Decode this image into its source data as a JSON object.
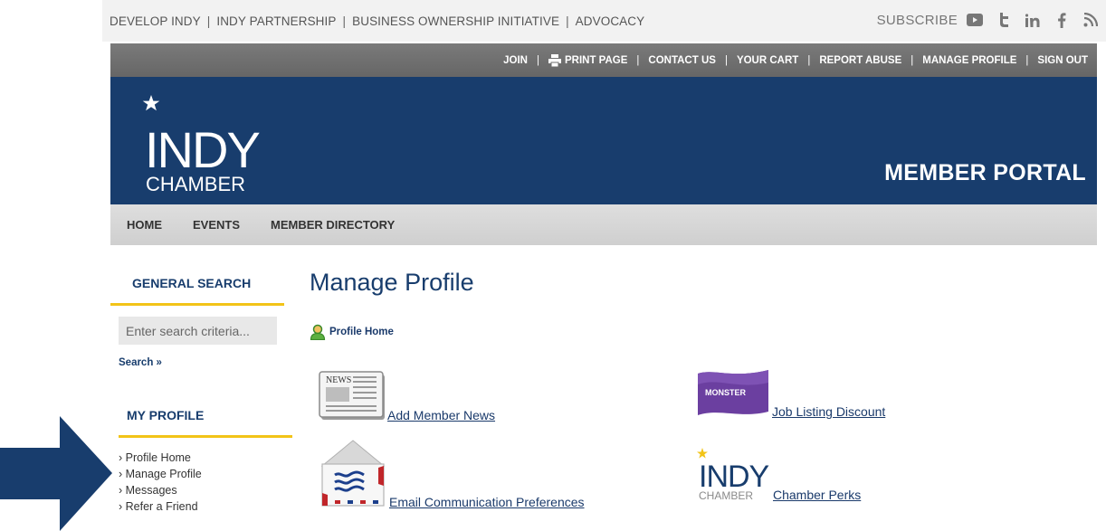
{
  "top_bar": {
    "links": [
      "DEVELOP INDY",
      "INDY PARTNERSHIP",
      "BUSINESS OWNERSHIP INITIATIVE",
      "ADVOCACY"
    ],
    "subscribe_label": "SUBSCRIBE",
    "social_icons": [
      "youtube-icon",
      "twitter-icon",
      "linkedin-icon",
      "facebook-icon",
      "rss-icon"
    ]
  },
  "action_bar": {
    "join": "JOIN",
    "print_page": "PRINT PAGE",
    "contact_us": "CONTACT US",
    "your_cart": "YOUR CART",
    "report_abuse": "REPORT ABUSE",
    "manage_profile": "MANAGE PROFILE",
    "sign_out": "SIGN OUT"
  },
  "header": {
    "logo_text_main": "INDY",
    "logo_text_sub": "CHAMBER",
    "portal_title": "MEMBER PORTAL"
  },
  "nav": {
    "home": "HOME",
    "events": "EVENTS",
    "member_directory": "MEMBER DIRECTORY"
  },
  "sidebar": {
    "search_heading": "GENERAL SEARCH",
    "search_placeholder": "Enter search criteria...",
    "search_link": "Search »",
    "profile_heading": "MY PROFILE",
    "profile_items": [
      "Profile Home",
      "Manage Profile",
      "Messages",
      "Refer a Friend"
    ]
  },
  "main": {
    "title": "Manage Profile",
    "profile_home_link": "Profile Home",
    "tiles": {
      "add_member_news": "Add Member News",
      "news_icon_text": "NEWS",
      "job_listing_discount": "Job Listing Discount",
      "monster_logo_text": "MONSTER",
      "email_preferences": "Email Communication Preferences",
      "chamber_perks": "Chamber Perks",
      "perks_logo_main": "INDY",
      "perks_logo_sub": "CHAMBER"
    }
  },
  "colors": {
    "brand_blue": "#183d6d",
    "accent_yellow": "#f2c418",
    "action_bar_gray": "#6e6e6e"
  }
}
